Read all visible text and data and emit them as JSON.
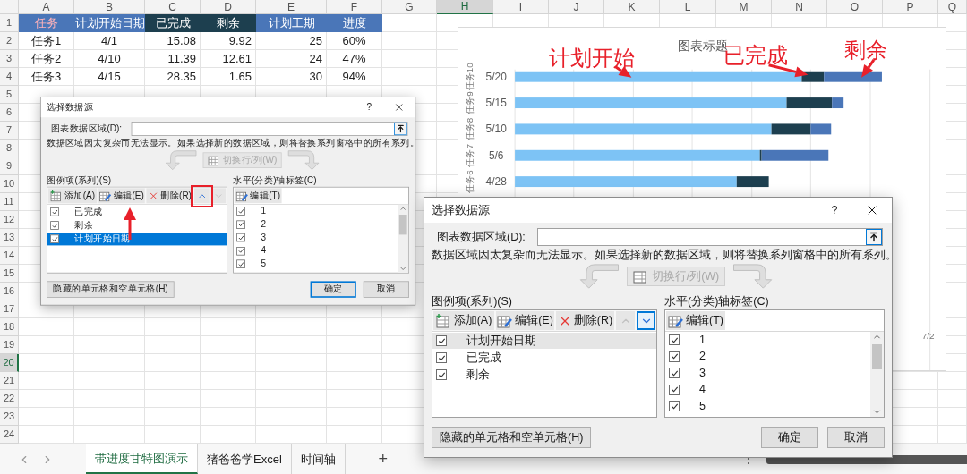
{
  "sheet": {
    "columns": [
      {
        "label": "A",
        "selected": false
      },
      {
        "label": "B",
        "selected": false
      },
      {
        "label": "C",
        "selected": false
      },
      {
        "label": "D",
        "selected": false
      },
      {
        "label": "E",
        "selected": false
      },
      {
        "label": "F",
        "selected": false
      },
      {
        "label": "G",
        "selected": false
      },
      {
        "label": "H",
        "selected": true
      },
      {
        "label": "I",
        "selected": false
      },
      {
        "label": "J",
        "selected": false
      },
      {
        "label": "K",
        "selected": false
      },
      {
        "label": "L",
        "selected": false
      },
      {
        "label": "M",
        "selected": false
      },
      {
        "label": "N",
        "selected": false
      },
      {
        "label": "O",
        "selected": false
      },
      {
        "label": "P",
        "selected": false
      },
      {
        "label": "Q",
        "selected": false
      }
    ],
    "row_numbers": [
      {
        "label": "1",
        "selected": false
      },
      {
        "label": "2",
        "selected": false
      },
      {
        "label": "3",
        "selected": false
      },
      {
        "label": "4",
        "selected": false
      },
      {
        "label": "5",
        "selected": false
      },
      {
        "label": "6",
        "selected": false
      },
      {
        "label": "7",
        "selected": false
      },
      {
        "label": "8",
        "selected": false
      },
      {
        "label": "9",
        "selected": false
      },
      {
        "label": "10",
        "selected": false
      },
      {
        "label": "11",
        "selected": false
      },
      {
        "label": "12",
        "selected": false
      },
      {
        "label": "13",
        "selected": false
      },
      {
        "label": "14",
        "selected": false
      },
      {
        "label": "15",
        "selected": false
      },
      {
        "label": "16",
        "selected": false
      },
      {
        "label": "17",
        "selected": false
      },
      {
        "label": "18",
        "selected": false
      },
      {
        "label": "19",
        "selected": false
      },
      {
        "label": "20",
        "selected": true
      },
      {
        "label": "21",
        "selected": false
      },
      {
        "label": "22",
        "selected": false
      },
      {
        "label": "23",
        "selected": false
      },
      {
        "label": "24",
        "selected": false
      }
    ],
    "header": [
      {
        "text": "任务",
        "kind": "key"
      },
      {
        "text": "计划开始日期",
        "kind": "plan"
      },
      {
        "text": "已完成",
        "kind": "done"
      },
      {
        "text": "剩余",
        "kind": "done"
      },
      {
        "text": "计划工期",
        "kind": "plan"
      },
      {
        "text": "进度",
        "kind": "plan"
      }
    ],
    "rows": [
      [
        "任务1",
        "4/1",
        "15.08",
        "9.92",
        "25",
        "60%"
      ],
      [
        "任务2",
        "4/10",
        "11.39",
        "12.61",
        "24",
        "47%"
      ],
      [
        "任务3",
        "4/15",
        "28.35",
        "1.65",
        "30",
        "94%"
      ]
    ]
  },
  "chart": {
    "title": "图表标题",
    "groups": [
      "任务10",
      "任务9",
      "任务8",
      "任务7",
      "任务6"
    ],
    "categories": [
      "5/20",
      "5/15",
      "5/10",
      "5/6",
      "4/28"
    ],
    "axis_end": "7/2",
    "callouts": [
      "计划开始",
      "已完成",
      "剩余"
    ]
  },
  "dialogs": [
    {
      "title": "选择数据源",
      "help": "?",
      "range_label": "图表数据区域(D):",
      "note": "数据区域因太复杂而无法显示。如果选择新的数据区域，则将替换系列窗格中的所有系列。",
      "switch_button": "切换行/列(W)",
      "switch_disabled": true,
      "series_label": "图例项(系列)(S)",
      "buttons": [
        "添加(A)",
        "编辑(E)",
        "删除(R)"
      ],
      "arrows": [
        {
          "kind": "up",
          "disabled": false,
          "focused": false
        },
        {
          "kind": "down",
          "disabled": true,
          "focused": false
        }
      ],
      "list_focused": true,
      "series": [
        {
          "label": "已完成",
          "checked": true,
          "selected": false
        },
        {
          "label": "剩余",
          "checked": true,
          "selected": false
        },
        {
          "label": "计划开始日期",
          "checked": true,
          "selected": true
        }
      ],
      "axis_label": "水平(分类)轴标签(C)",
      "axis_edit": "编辑(T)",
      "axis_items": [
        {
          "label": "1",
          "checked": true
        },
        {
          "label": "2",
          "checked": true
        },
        {
          "label": "3",
          "checked": true
        },
        {
          "label": "4",
          "checked": true
        },
        {
          "label": "5",
          "checked": true
        }
      ],
      "hidden_button": "隐藏的单元格和空单元格(H)",
      "ok": "确定",
      "ok_default": true,
      "cancel": "取消"
    },
    {
      "title": "选择数据源",
      "help": "?",
      "range_label": "图表数据区域(D):",
      "note": "数据区域因太复杂而无法显示。如果选择新的数据区域，则将替换系列窗格中的所有系列。",
      "switch_button": "切换行/列(W)",
      "switch_disabled": true,
      "series_label": "图例项(系列)(S)",
      "buttons": [
        "添加(A)",
        "编辑(E)",
        "删除(R)"
      ],
      "arrows": [
        {
          "kind": "up",
          "disabled": true,
          "focused": false
        },
        {
          "kind": "down",
          "disabled": false,
          "focused": true
        }
      ],
      "list_focused": false,
      "series": [
        {
          "label": "计划开始日期",
          "checked": true,
          "selected": true
        },
        {
          "label": "已完成",
          "checked": true,
          "selected": false
        },
        {
          "label": "剩余",
          "checked": true,
          "selected": false
        }
      ],
      "axis_label": "水平(分类)轴标签(C)",
      "axis_edit": "编辑(T)",
      "axis_items": [
        {
          "label": "1",
          "checked": true
        },
        {
          "label": "2",
          "checked": true
        },
        {
          "label": "3",
          "checked": true
        },
        {
          "label": "4",
          "checked": true
        },
        {
          "label": "5",
          "checked": true
        }
      ],
      "hidden_button": "隐藏的单元格和空单元格(H)",
      "ok": "确定",
      "ok_default": false,
      "cancel": "取消"
    }
  ],
  "sheet_tabs": [
    {
      "label": "带进度甘特图演示",
      "selected": true
    },
    {
      "label": "猪爸爸学Excel",
      "selected": false
    },
    {
      "label": "时间轴",
      "selected": false
    }
  ],
  "add_tab": "+",
  "more_button": "⋮"
}
